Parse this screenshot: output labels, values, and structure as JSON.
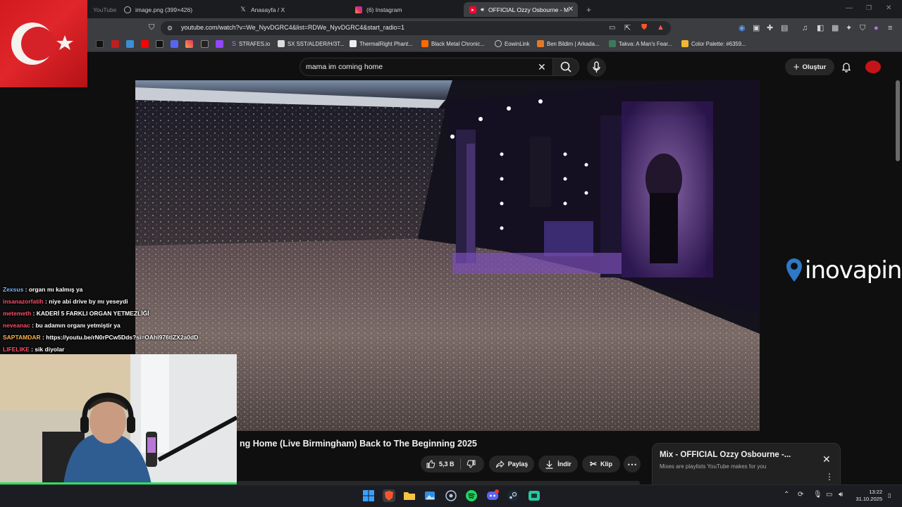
{
  "browser": {
    "tabs": [
      {
        "label": "YouTube",
        "icon": "youtube-icon"
      },
      {
        "label": "image.png (399×426)",
        "icon": "globe-icon"
      },
      {
        "label": "Anasayfa / X",
        "icon": "x-icon"
      },
      {
        "label": "(6) Instagram",
        "icon": "instagram-icon"
      },
      {
        "label": "OFFICIAL Ozzy Osbourne - M",
        "icon": "youtube-icon"
      }
    ],
    "new_tab": "+",
    "url": "youtube.com/watch?v=We_NyvDGRC4&list=RDWe_NyvDGRC4&start_radio=1",
    "bookmarks": [
      "STRAFES.io",
      "SX SST/ALDER/H/3T...",
      "ThermalRight Phant...",
      "Black Metal Chronic...",
      "EowinLink",
      "Ben Bildim | Arkada...",
      "Takva: A Man's Fear...",
      "Color Palette: #6359..."
    ]
  },
  "youtube": {
    "search_query": "mama im coming home",
    "create_label": "Oluştur",
    "video_title": "ng Home (Live Birmingham) Back to The Beginning 2025",
    "actions": {
      "likes": "5,3 B",
      "share": "Paylaş",
      "download": "İndir",
      "clip": "Klip"
    },
    "mix": {
      "title": "Mix - OFFICIAL Ozzy Osbourne -...",
      "subtitle": "Mixes are playlists YouTube makes for you"
    }
  },
  "overlay": {
    "sponsor": "inovapin",
    "chat": [
      {
        "user": "Zexsus",
        "color": "#7ab6ff",
        "text": "organ mı kalmış ya"
      },
      {
        "user": "insanazorfatih",
        "color": "#ff4d6a",
        "text": "niye abi drive by mı yeseydi"
      },
      {
        "user": "metemeth",
        "color": "#ff4d6a",
        "text": "KADERİ 5 FARKLI ORGAN YETMEZLİĞİ"
      },
      {
        "user": "neveanac",
        "color": "#ff4d6a",
        "text": "bu adamın organı yetmiştir ya"
      },
      {
        "user": "SAPTAMDAR",
        "color": "#ffb347",
        "text": "https://youtu.be/rN0rPCw5Dds?si=OAhI976tlZX2a0dD"
      },
      {
        "user": "LIFELIKE",
        "color": "#ff4d6a",
        "text": "sik diyolar"
      }
    ]
  },
  "system": {
    "time": "13:22",
    "date": "31.10.2025"
  }
}
